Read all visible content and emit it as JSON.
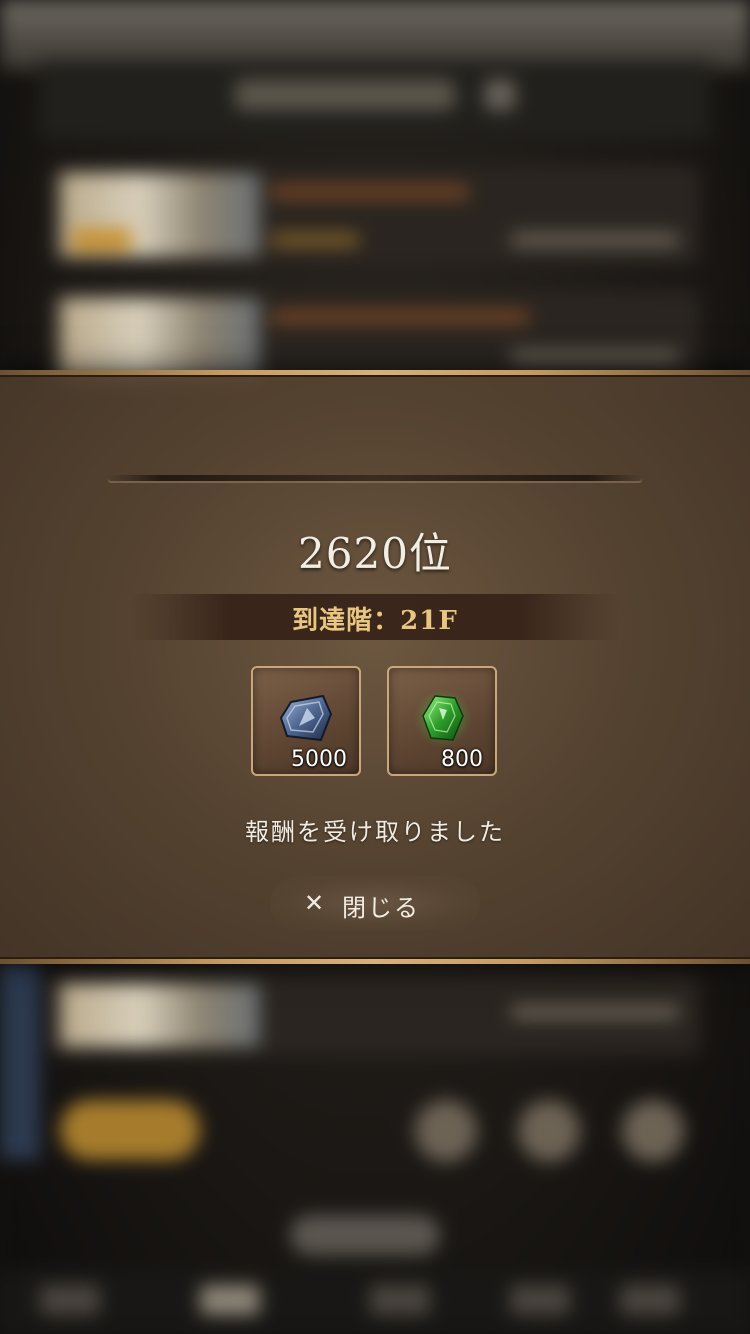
{
  "result": {
    "rank": "2620位",
    "floor_label": "到達階：21F"
  },
  "rewards": [
    {
      "icon": "blue-ore-icon",
      "quantity": "5000"
    },
    {
      "icon": "green-gem-icon",
      "quantity": "800"
    }
  ],
  "message": "報酬を受け取りました",
  "close_button": {
    "icon": "close-icon",
    "label": "閉じる"
  },
  "colors": {
    "floor_text": "#e8c580",
    "border_gold": "#c79c62",
    "panel_brown": "#5c4834"
  }
}
